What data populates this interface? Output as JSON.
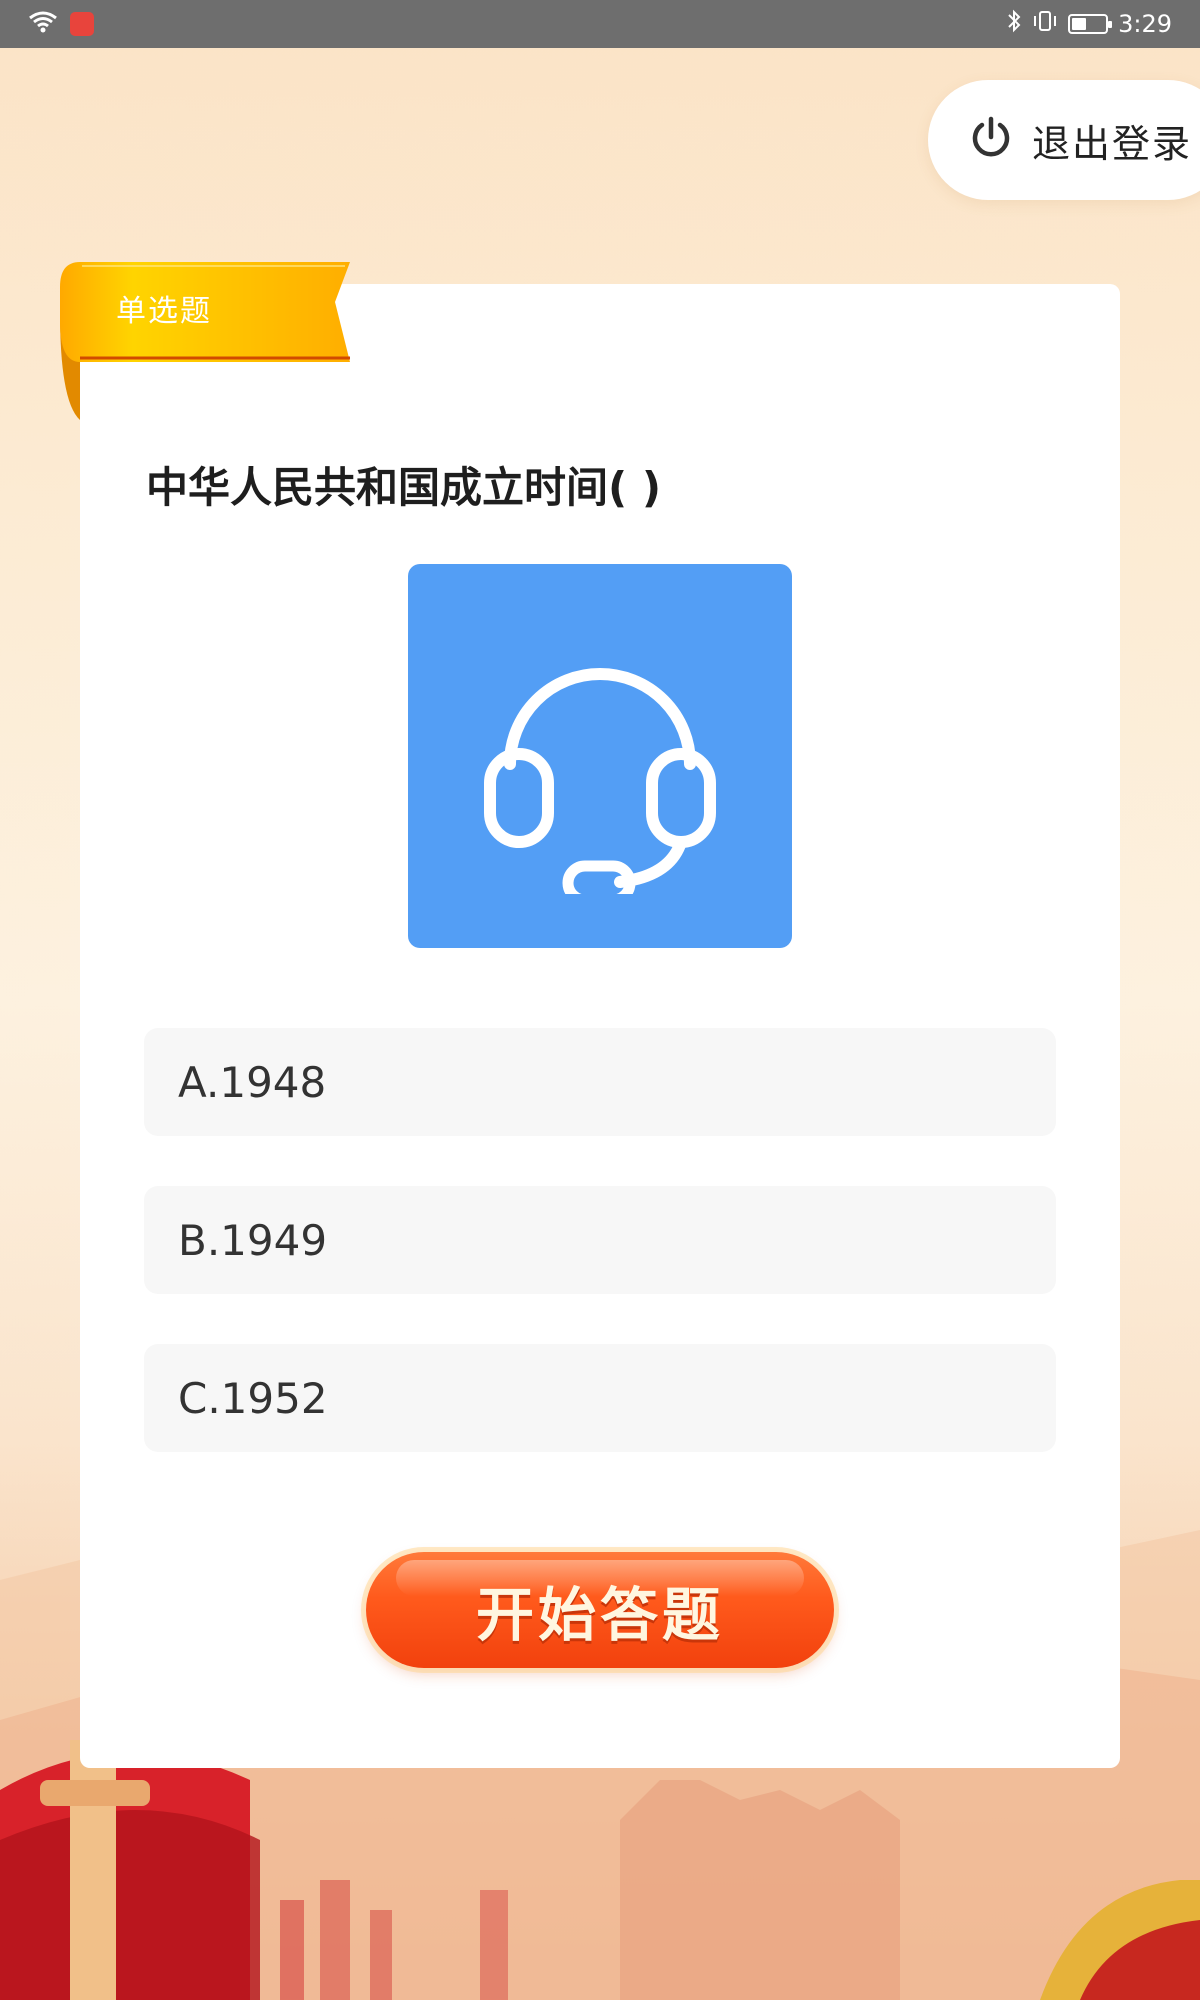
{
  "status_bar": {
    "time": "3:29",
    "icons": [
      "wifi-icon",
      "app-badge-icon",
      "bluetooth-icon",
      "vibrate-icon",
      "battery-icon"
    ]
  },
  "logout": {
    "label": "退出登录",
    "icon": "power-icon"
  },
  "question": {
    "type_label": "单选题",
    "text": "中华人民共和国成立时间( )",
    "image_icon": "headset-icon",
    "image_color": "#539ef5",
    "options": [
      "A.1948",
      "B.1949",
      "C.1952"
    ]
  },
  "start_button": {
    "label": "开始答题"
  },
  "colors": {
    "ribbon": "#ffb400",
    "button": "#ff5a1c",
    "status_bar": "#6e6e6e"
  }
}
